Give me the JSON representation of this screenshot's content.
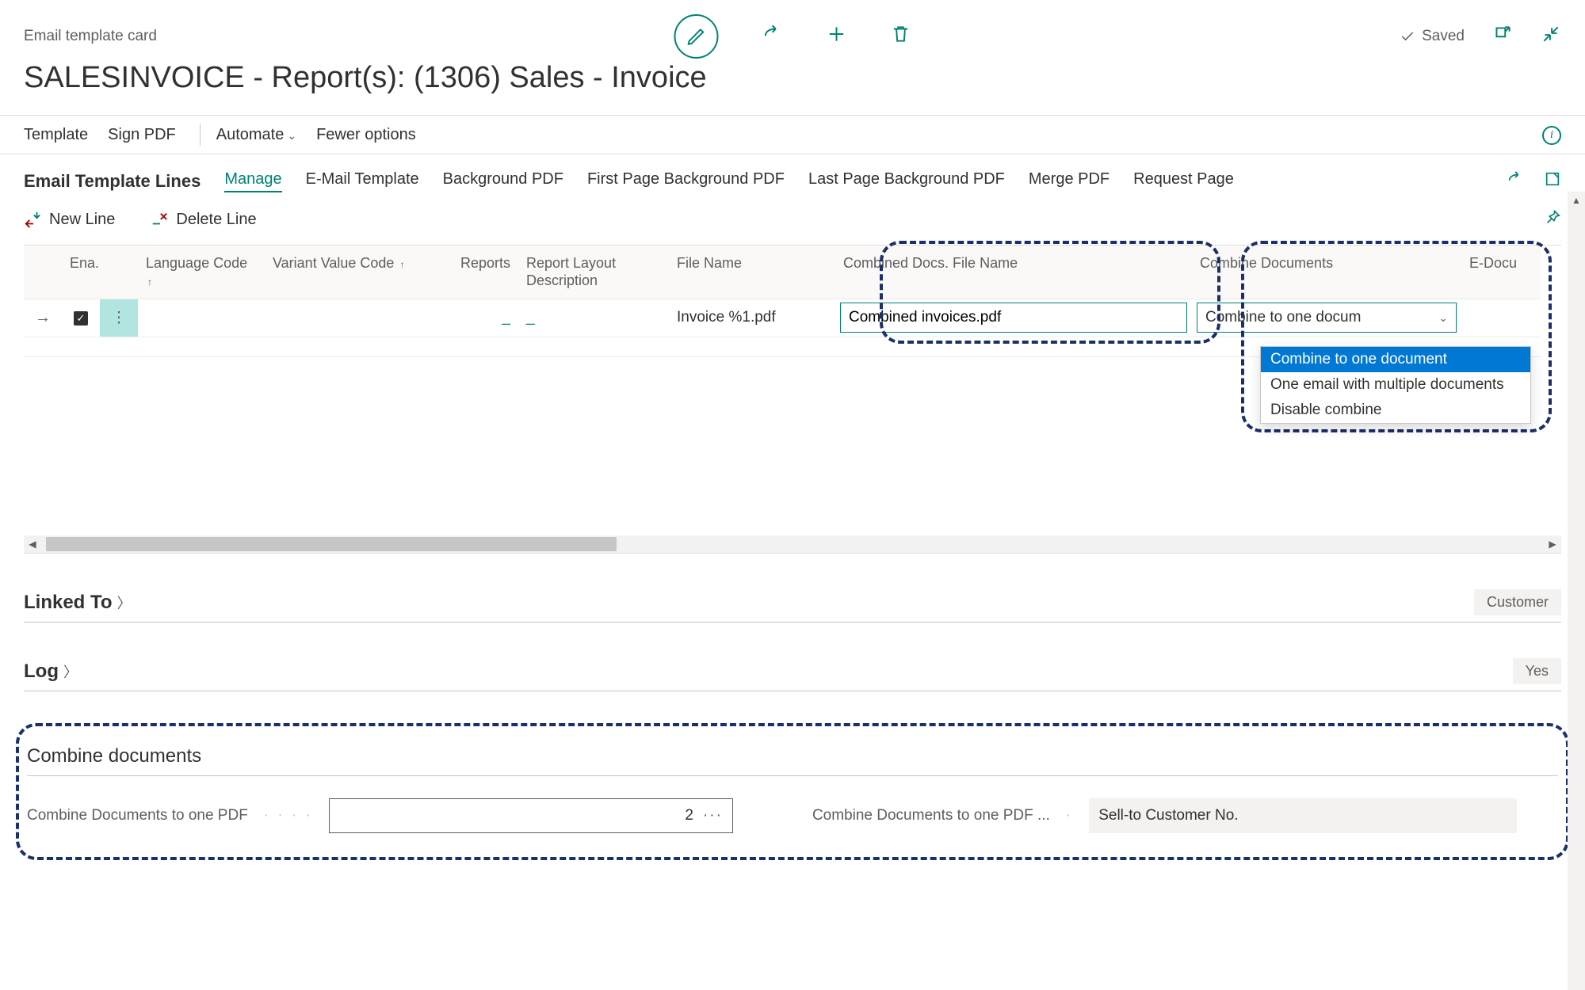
{
  "header": {
    "breadcrumb": "Email template card",
    "saved_label": "Saved"
  },
  "title": "SALESINVOICE - Report(s): (1306) Sales - Invoice",
  "cmdbar": {
    "template": "Template",
    "sign_pdf": "Sign PDF",
    "automate": "Automate",
    "fewer_options": "Fewer options"
  },
  "lines": {
    "title": "Email Template Lines",
    "tabs": {
      "manage": "Manage",
      "email_template": "E-Mail Template",
      "background_pdf": "Background PDF",
      "first_page_bg": "First Page Background PDF",
      "last_page_bg": "Last Page Background PDF",
      "merge_pdf": "Merge PDF",
      "request_page": "Request Page"
    },
    "actions": {
      "new_line": "New Line",
      "delete_line": "Delete Line"
    },
    "columns": {
      "enabled": "Ena...",
      "language_code": "Language Code",
      "variant_value_code": "Variant Value Code",
      "reports": "Reports",
      "report_layout_desc": "Report Layout Description",
      "file_name": "File Name",
      "combined_file_name": "Combined Docs. File Name",
      "combine_documents": "Combine Documents",
      "e_docu": "E-Docu"
    },
    "row": {
      "file_name": "Invoice %1.pdf",
      "combined_file_name": "Combined invoices.pdf",
      "combine_value": "Combine to one docum"
    },
    "dropdown": {
      "opt1": "Combine to one document",
      "opt2": "One email with multiple documents",
      "opt3": "Disable combine"
    }
  },
  "linked_to": {
    "title": "Linked To",
    "badge": "Customer"
  },
  "log": {
    "title": "Log",
    "badge": "Yes"
  },
  "combine": {
    "title": "Combine documents",
    "label1": "Combine Documents to one PDF",
    "value1": "2",
    "label2": "Combine Documents to one PDF ...",
    "value2": "Sell-to Customer No."
  }
}
